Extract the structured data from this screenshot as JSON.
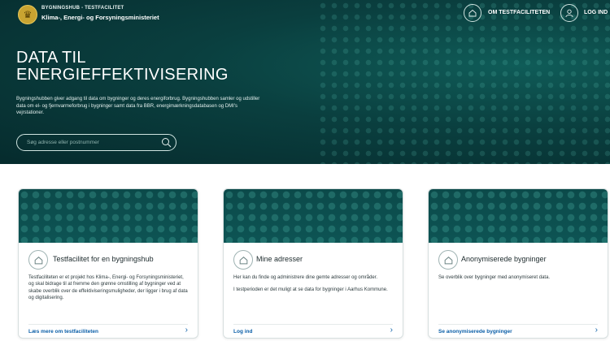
{
  "header": {
    "brand_line1": "BYGNINGSHUB - TESTFACILITET",
    "brand_line2": "Klima-, Energi- og Forsyningsministeriet",
    "crest_icon": "crown-icon",
    "nav": [
      {
        "label": "OM TESTFACILITETEN",
        "icon": "house-icon"
      },
      {
        "label": "LOG IND",
        "icon": "user-icon"
      }
    ]
  },
  "hero": {
    "title_line1": "DATA TIL",
    "title_line2": "ENERGIEFFEKTIVISERING",
    "description": "Bygningshubben giver adgang til data om bygninger og deres energiforbrug. Bygningshubben samler og udstiller data om el- og fjernvarmeforbrug i bygninger samt data fra BBR, energimærkningsdatabasen og DMI's vejrstationer.",
    "search_placeholder": "Søg adresse eller postnummer"
  },
  "cards": [
    {
      "title": "Testfacilitet for en bygningshub",
      "paragraphs": [
        "Testfaciliteten er et projekt hos Klima-, Energi- og Forsyningsministeriet, og skal bidrage til at fremme den grønne omstilling af bygninger ved at skabe overblik over de effektiviseringsmuligheder, der ligger i brug af data og digitalisering."
      ],
      "link": "Læs mere om testfaciliteten"
    },
    {
      "title": "Mine adresser",
      "paragraphs": [
        "Her kan du finde og administrere dine gemte adresser og områder.",
        "I testperioden er det muligt at se data for bygninger i Aarhus Kommune."
      ],
      "link": "Log ind"
    },
    {
      "title": "Anonymiserede bygninger",
      "paragraphs": [
        "Se overblik over bygninger med anonymiseret data."
      ],
      "link": "Se anonymiserede bygninger"
    }
  ],
  "colors": {
    "hero_bg": "#0a3f3f",
    "link": "#0b5fa8",
    "crest": "#c9a431"
  }
}
